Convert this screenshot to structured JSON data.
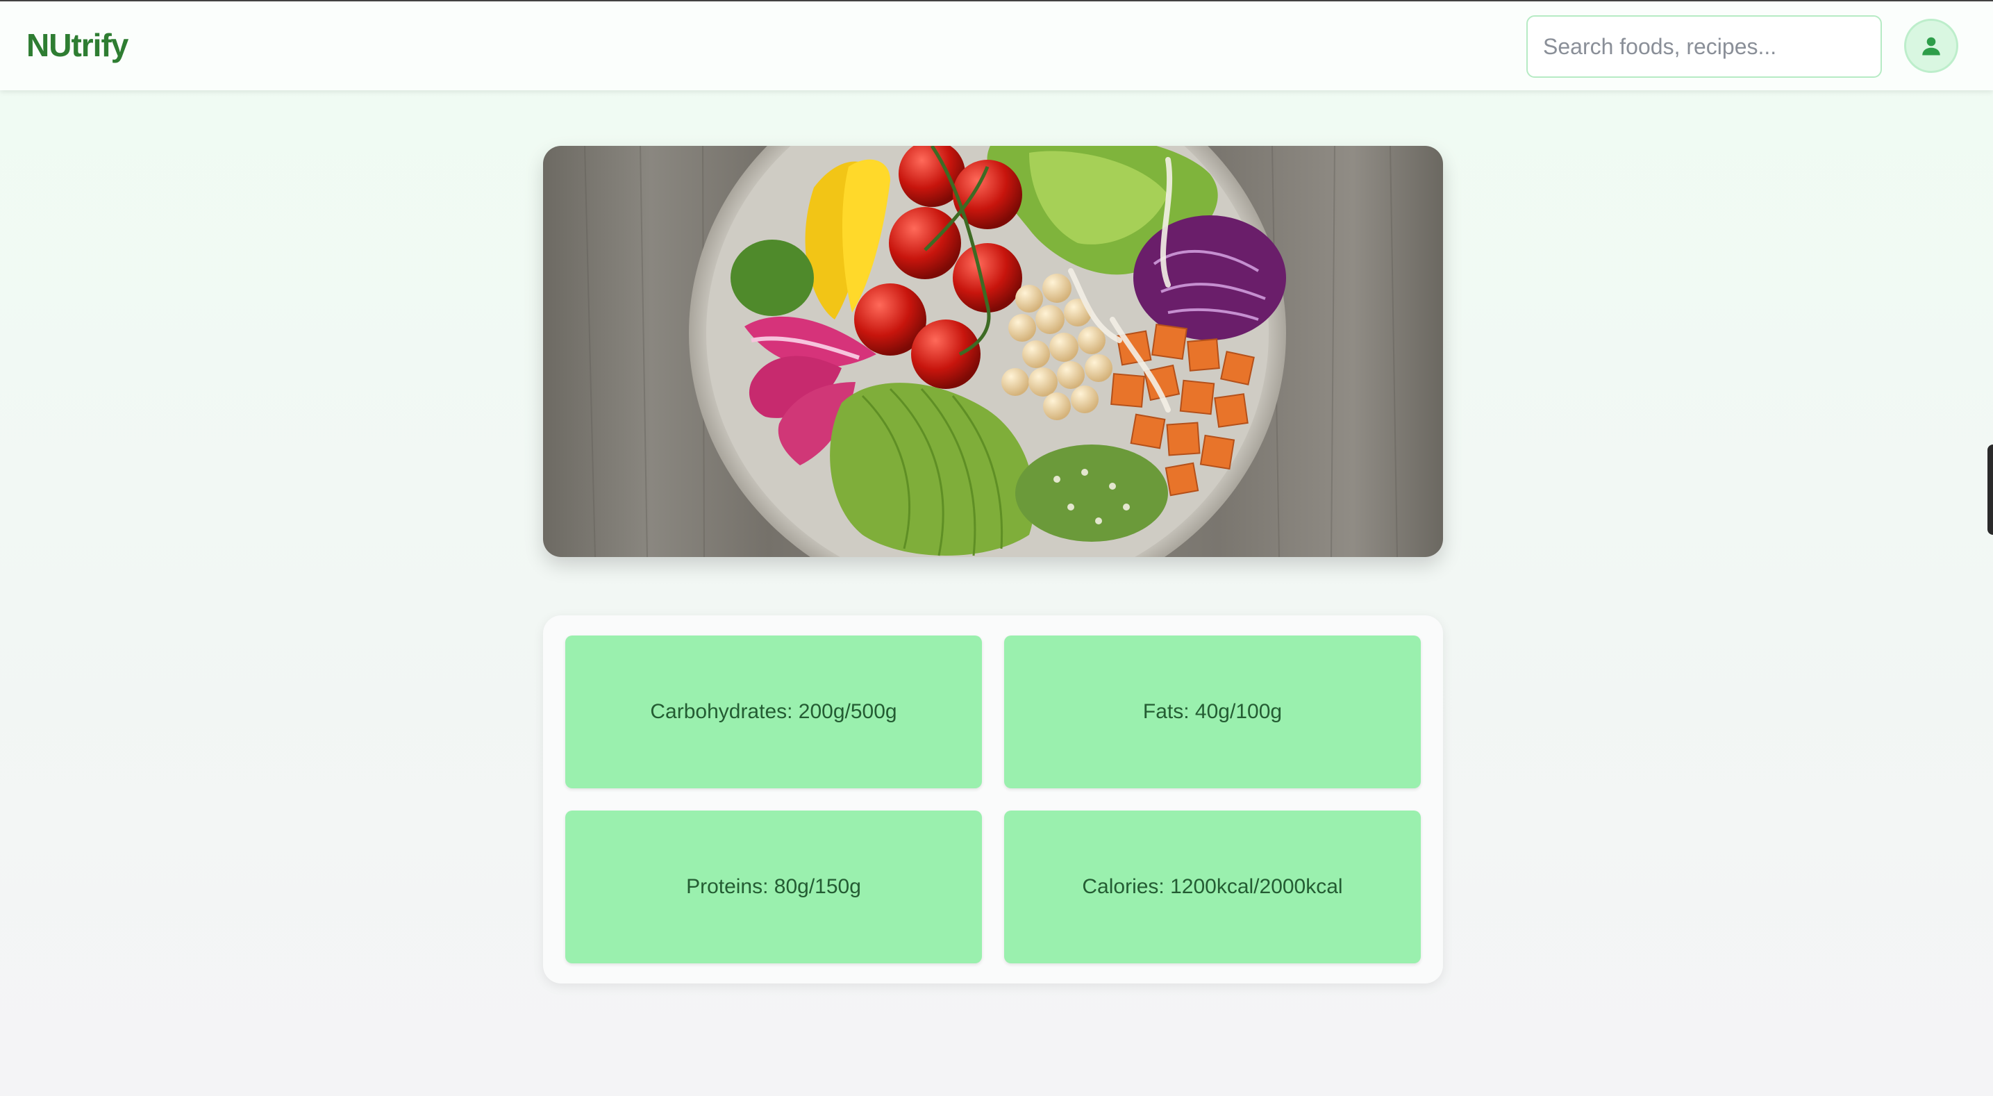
{
  "header": {
    "logo": "NUtrify",
    "search_placeholder": "Search foods, recipes...",
    "search_value": ""
  },
  "icons": {
    "user": "user-icon"
  },
  "hero": {
    "image": "salad-bowl-photo"
  },
  "nutrition": {
    "carbohydrates": "Carbohydrates: 200g/500g",
    "fats": "Fats: 40g/100g",
    "proteins": "Proteins: 80g/150g",
    "calories": "Calories: 1200kcal/2000kcal"
  },
  "colors": {
    "brand": "#2e7d32",
    "card": "#9af0ae",
    "search_border": "#b6ebc4"
  }
}
